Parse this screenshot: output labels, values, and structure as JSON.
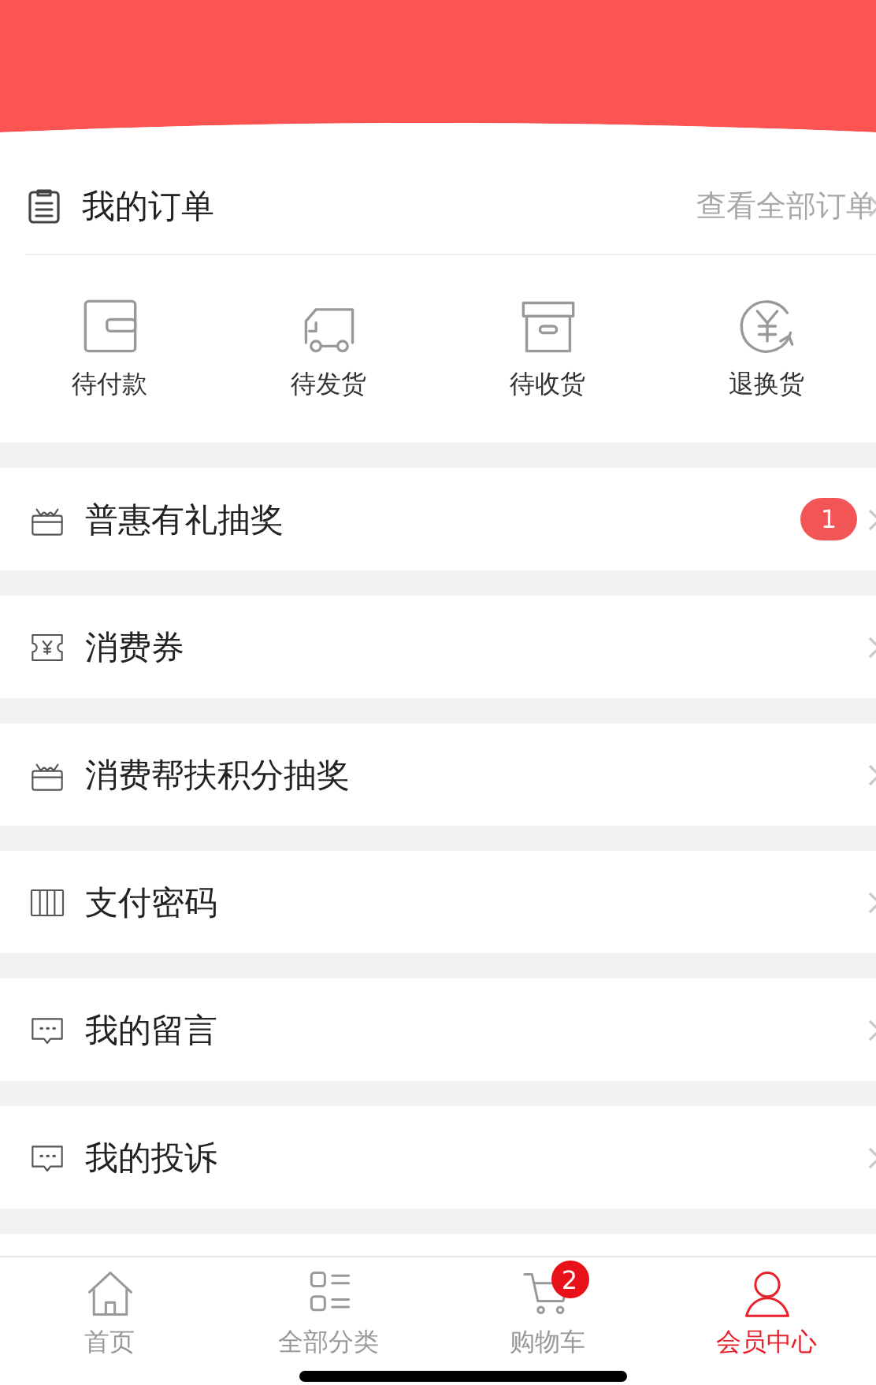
{
  "orders": {
    "title": "我的订单",
    "view_all": "查看全部订单",
    "statuses": [
      {
        "label": "待付款",
        "kind": "wallet"
      },
      {
        "label": "待发货",
        "kind": "truck"
      },
      {
        "label": "待收货",
        "kind": "box"
      },
      {
        "label": "退换货",
        "kind": "refund"
      }
    ]
  },
  "menu": [
    {
      "label": "普惠有礼抽奖",
      "kind": "gift",
      "badge": "1"
    },
    {
      "label": "消费券",
      "kind": "ticket"
    },
    {
      "label": "消费帮扶积分抽奖",
      "kind": "gift"
    },
    {
      "label": "支付密码",
      "kind": "columns"
    },
    {
      "label": "我的留言",
      "kind": "message"
    },
    {
      "label": "我的投诉",
      "kind": "message"
    }
  ],
  "tab_bar": [
    {
      "label": "首页",
      "kind": "home",
      "selected": false
    },
    {
      "label": "全部分类",
      "kind": "grid",
      "selected": false
    },
    {
      "label": "购物车",
      "kind": "cart",
      "selected": false,
      "badge": "2"
    },
    {
      "label": "会员中心",
      "kind": "user",
      "selected": true
    }
  ]
}
